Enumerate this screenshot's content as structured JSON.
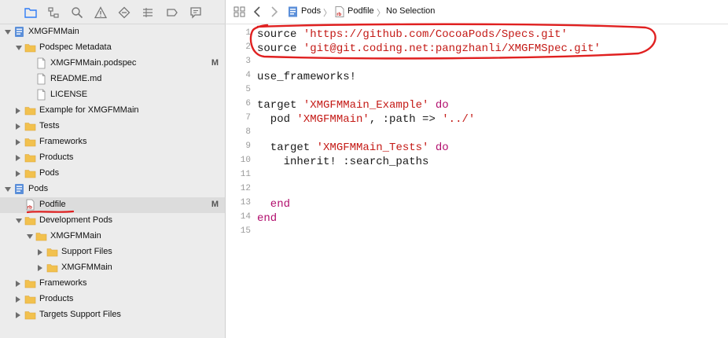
{
  "navigator": {
    "toolbar_icons": [
      "folder-icon",
      "hierarchy-icon",
      "search-icon",
      "warning-icon",
      "diamond-icon",
      "grid-icon",
      "tag-icon",
      "comment-icon"
    ],
    "items": [
      {
        "label": "XMGFMMain",
        "indent": 0,
        "icon": "project-icon",
        "disclosure": "open"
      },
      {
        "label": "Podspec Metadata",
        "indent": 1,
        "icon": "folder-icon",
        "disclosure": "open"
      },
      {
        "label": "XMGFMMain.podspec",
        "indent": 2,
        "icon": "file-icon",
        "disclosure": "none",
        "badge": "M"
      },
      {
        "label": "README.md",
        "indent": 2,
        "icon": "file-icon",
        "disclosure": "none"
      },
      {
        "label": "LICENSE",
        "indent": 2,
        "icon": "file-icon",
        "disclosure": "none"
      },
      {
        "label": "Example for XMGFMMain",
        "indent": 1,
        "icon": "folder-icon",
        "disclosure": "closed"
      },
      {
        "label": "Tests",
        "indent": 1,
        "icon": "folder-icon",
        "disclosure": "closed"
      },
      {
        "label": "Frameworks",
        "indent": 1,
        "icon": "folder-icon",
        "disclosure": "closed"
      },
      {
        "label": "Products",
        "indent": 1,
        "icon": "folder-icon",
        "disclosure": "closed"
      },
      {
        "label": "Pods",
        "indent": 1,
        "icon": "folder-icon",
        "disclosure": "closed"
      },
      {
        "label": "Pods",
        "indent": 0,
        "icon": "project-icon",
        "disclosure": "open"
      },
      {
        "label": "Podfile",
        "indent": 1,
        "icon": "ruby-file-icon",
        "disclosure": "none",
        "badge": "M",
        "selected": true
      },
      {
        "label": "Development Pods",
        "indent": 1,
        "icon": "folder-icon",
        "disclosure": "open"
      },
      {
        "label": "XMGFMMain",
        "indent": 2,
        "icon": "folder-icon",
        "disclosure": "open"
      },
      {
        "label": "Support Files",
        "indent": 3,
        "icon": "folder-icon",
        "disclosure": "closed"
      },
      {
        "label": "XMGFMMain",
        "indent": 3,
        "icon": "folder-icon",
        "disclosure": "closed"
      },
      {
        "label": "Frameworks",
        "indent": 1,
        "icon": "folder-icon",
        "disclosure": "closed"
      },
      {
        "label": "Products",
        "indent": 1,
        "icon": "folder-icon",
        "disclosure": "closed"
      },
      {
        "label": "Targets Support Files",
        "indent": 1,
        "icon": "folder-icon",
        "disclosure": "closed"
      }
    ]
  },
  "jumpbar": {
    "crumb1": "Pods",
    "crumb2": "Podfile",
    "crumb3": "No Selection"
  },
  "code_lines": [
    {
      "n": "1",
      "tokens": [
        {
          "t": "source ",
          "c": "plain"
        },
        {
          "t": "'https://github.com/CocoaPods/Specs.git'",
          "c": "str"
        }
      ]
    },
    {
      "n": "2",
      "tokens": [
        {
          "t": "source ",
          "c": "plain"
        },
        {
          "t": "'git@git.coding.net:pangzhanli/XMGFMSpec.git'",
          "c": "str"
        }
      ]
    },
    {
      "n": "3",
      "tokens": []
    },
    {
      "n": "4",
      "tokens": [
        {
          "t": "use_frameworks!",
          "c": "plain"
        }
      ]
    },
    {
      "n": "5",
      "tokens": []
    },
    {
      "n": "6",
      "tokens": [
        {
          "t": "target ",
          "c": "plain"
        },
        {
          "t": "'XMGFMMain_Example'",
          "c": "str"
        },
        {
          "t": " do",
          "c": "kw"
        }
      ]
    },
    {
      "n": "7",
      "tokens": [
        {
          "t": "  pod ",
          "c": "plain"
        },
        {
          "t": "'XMGFMMain'",
          "c": "str"
        },
        {
          "t": ", :path => ",
          "c": "plain"
        },
        {
          "t": "'../'",
          "c": "str"
        }
      ]
    },
    {
      "n": "8",
      "tokens": []
    },
    {
      "n": "9",
      "tokens": [
        {
          "t": "  target ",
          "c": "plain"
        },
        {
          "t": "'XMGFMMain_Tests'",
          "c": "str"
        },
        {
          "t": " do",
          "c": "kw"
        }
      ]
    },
    {
      "n": "10",
      "tokens": [
        {
          "t": "    inherit! :search_paths",
          "c": "plain"
        }
      ]
    },
    {
      "n": "11",
      "tokens": []
    },
    {
      "n": "12",
      "tokens": []
    },
    {
      "n": "13",
      "tokens": [
        {
          "t": "  end",
          "c": "kw"
        }
      ]
    },
    {
      "n": "14",
      "tokens": [
        {
          "t": "end",
          "c": "kw"
        }
      ]
    },
    {
      "n": "15",
      "tokens": []
    }
  ],
  "colors": {
    "folder": "#f2c14e",
    "keyword": "#b20e6d",
    "string": "#c41a16",
    "annotation": "#e02020",
    "selection": "#dcdcdc"
  }
}
